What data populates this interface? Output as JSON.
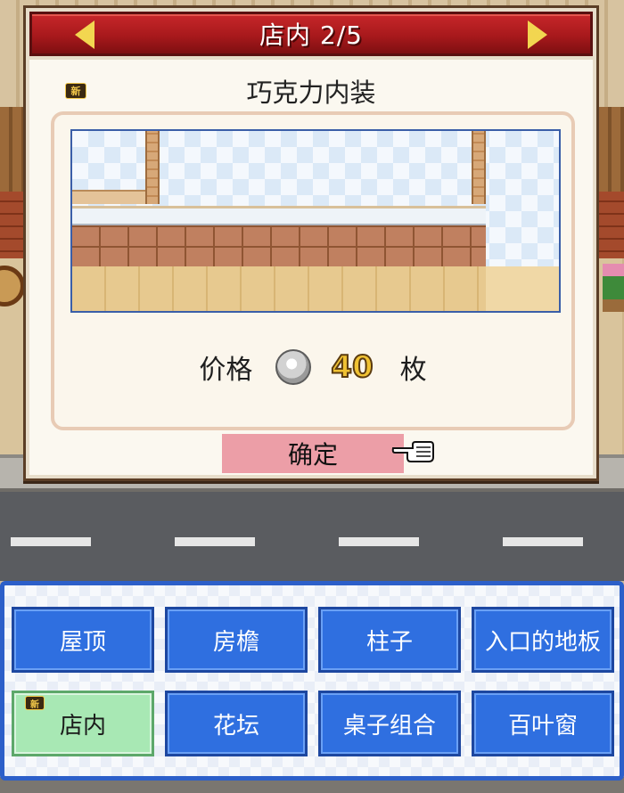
{
  "dialog": {
    "title": "店内 2/5",
    "new_badge": "新",
    "item_name": "巧克力内装",
    "price_label": "价格",
    "price_value": "40",
    "price_unit": "枚",
    "confirm_label": "确定"
  },
  "menu": {
    "categories": [
      {
        "label": "屋顶"
      },
      {
        "label": "房檐"
      },
      {
        "label": "柱子"
      },
      {
        "label": "入口的地板"
      },
      {
        "label": "店内",
        "selected": true,
        "new_badge": "新"
      },
      {
        "label": "花坛"
      },
      {
        "label": "桌子组合"
      },
      {
        "label": "百叶窗"
      }
    ]
  },
  "icons": {
    "prev": "arrow-left-icon",
    "next": "arrow-right-icon",
    "coin": "silver-coin-icon",
    "pointer": "pointing-hand-icon"
  },
  "colors": {
    "title_bar": "#b01e21",
    "arrow": "#f2d650",
    "confirm": "#ec9ea7",
    "category": "#2f6fe0",
    "category_selected": "#a8e8b4",
    "price": "#f0c233"
  }
}
